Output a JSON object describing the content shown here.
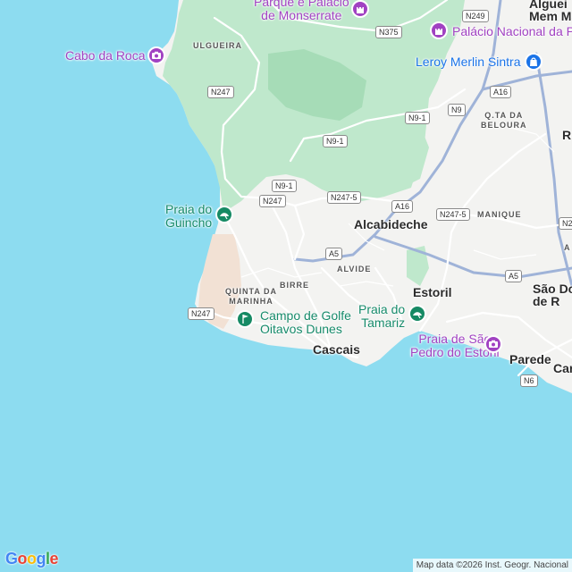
{
  "map": {
    "places": [
      {
        "id": "alcabideche",
        "name": "Alcabideche"
      },
      {
        "id": "estoril",
        "name": "Estoril"
      },
      {
        "id": "cascais",
        "name": "Cascais"
      },
      {
        "id": "parede",
        "name": "Parede"
      },
      {
        "id": "sdp",
        "name": "São Do\nde R"
      },
      {
        "id": "alg",
        "name": "Alguei\nMem Ma"
      },
      {
        "id": "rtop",
        "name": "R"
      },
      {
        "id": "car",
        "name": "Car"
      }
    ],
    "areas": [
      {
        "id": "ulgueira",
        "name": "ULGUEIRA"
      },
      {
        "id": "qtabeloura",
        "name": "Q.TA DA\nBELOURA"
      },
      {
        "id": "manique",
        "name": "MANIQUE"
      },
      {
        "id": "alvide",
        "name": "ALVIDE"
      },
      {
        "id": "birre",
        "name": "BIRRE"
      },
      {
        "id": "quintamarinha",
        "name": "QUINTA DA\nMARINHA"
      },
      {
        "id": "aright",
        "name": "A"
      }
    ],
    "pois": [
      {
        "id": "cabo-roca",
        "name": "Cabo da Roca",
        "kind": "photo-icon",
        "color": "#a142c2"
      },
      {
        "id": "monserrate",
        "name": "Parque e Palácio\nde Monserrate",
        "kind": "castle-icon",
        "color": "#a142c2"
      },
      {
        "id": "palacio",
        "name": "Palácio Nacional da P",
        "kind": "photo-icon",
        "color": "#a142c2"
      },
      {
        "id": "leroy",
        "name": "Leroy Merlin Sintra",
        "kind": "shopping-bag-icon",
        "color": "#1a73e8"
      },
      {
        "id": "guincho",
        "name": "Praia do\nGuincho",
        "kind": "beach-icon",
        "color": "#168a64"
      },
      {
        "id": "oitavos",
        "name": "Campo de Golfe\nOitavos Dunes",
        "kind": "golf-icon",
        "color": "#168a64"
      },
      {
        "id": "tamariz",
        "name": "Praia do\nTamariz",
        "kind": "beach-icon",
        "color": "#168a64"
      },
      {
        "id": "sao-pedro",
        "name": "Praia de São\nPedro do Estoril",
        "kind": "photo-icon",
        "color": "#a142c2"
      }
    ],
    "roads": [
      "N249",
      "N375",
      "N247",
      "A16",
      "N9",
      "N9-1",
      "N9-1",
      "N9-1",
      "N247",
      "N247-5",
      "A16",
      "N247-5",
      "N2",
      "A5",
      "A5",
      "N247",
      "N6"
    ],
    "colors": {
      "water": "#8ddcf0",
      "land": "#f3f3f1",
      "park": "#bfe8cc",
      "parkDark": "#a6dcb7",
      "sand": "#f2e1d4",
      "road": "#ffffff",
      "highway": "#9fb3d8"
    }
  },
  "footer": {
    "logo": {
      "g1": "G",
      "o1": "o",
      "o2": "o",
      "g2": "g",
      "l": "l",
      "e": "e"
    },
    "attribution": "Map data ©2026 Inst. Geogr. Nacional"
  }
}
